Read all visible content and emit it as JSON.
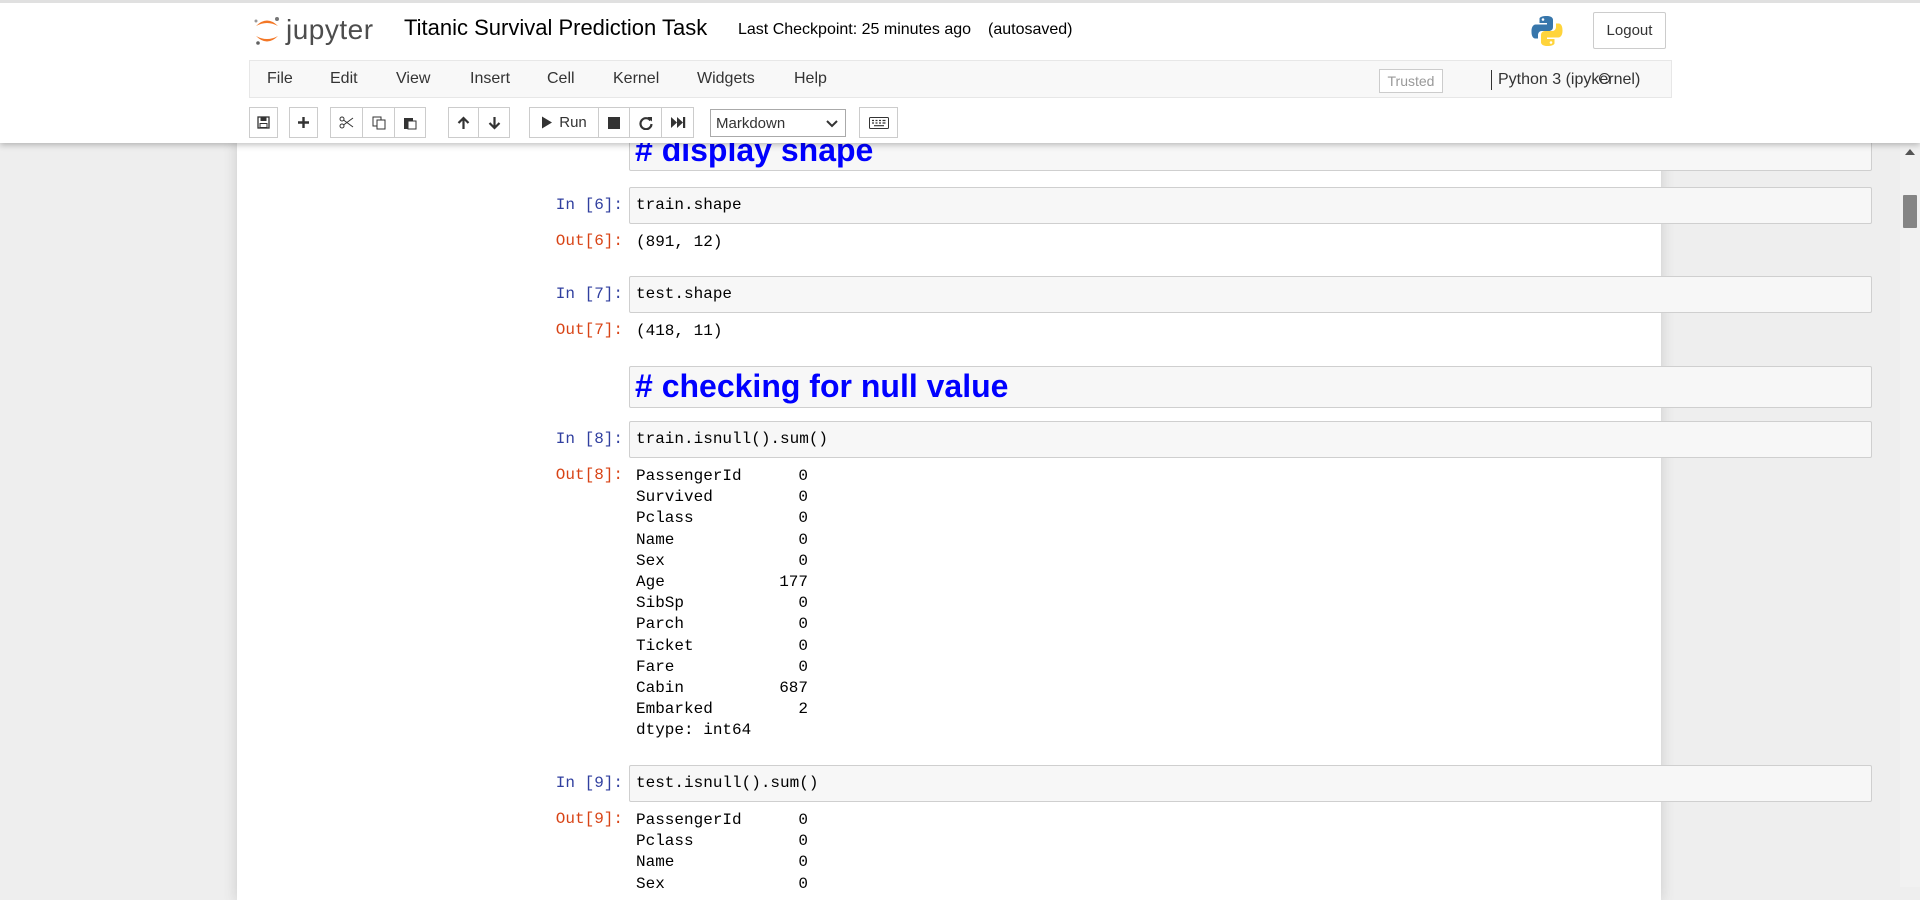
{
  "header": {
    "logo_text": "jupyter",
    "notebook_title": "Titanic Survival Prediction Task",
    "checkpoint": "Last Checkpoint: 25 minutes ago",
    "autosave_status": "(autosaved)",
    "logout_label": "Logout"
  },
  "menubar": {
    "items": [
      "File",
      "Edit",
      "View",
      "Insert",
      "Cell",
      "Kernel",
      "Widgets",
      "Help"
    ],
    "trusted_label": "Trusted",
    "kernel_name": "Python 3 (ipykernel)"
  },
  "toolbar": {
    "run_label": "Run",
    "cell_type": "Markdown"
  },
  "cells": {
    "md1": "# display shape",
    "in6": {
      "prompt": "In [6]:",
      "code": "train.shape"
    },
    "out6": {
      "prompt": "Out[6]:",
      "text": "(891, 12)"
    },
    "in7": {
      "prompt": "In [7]:",
      "code": "test.shape"
    },
    "out7": {
      "prompt": "Out[7]:",
      "text": "(418, 11)"
    },
    "md2": "# checking for null value",
    "in8": {
      "prompt": "In [8]:",
      "code": "train.isnull().sum()"
    },
    "out8": {
      "prompt": "Out[8]:",
      "rows": [
        {
          "k": "PassengerId",
          "v": "0"
        },
        {
          "k": "Survived",
          "v": "0"
        },
        {
          "k": "Pclass",
          "v": "0"
        },
        {
          "k": "Name",
          "v": "0"
        },
        {
          "k": "Sex",
          "v": "0"
        },
        {
          "k": "Age",
          "v": "177"
        },
        {
          "k": "SibSp",
          "v": "0"
        },
        {
          "k": "Parch",
          "v": "0"
        },
        {
          "k": "Ticket",
          "v": "0"
        },
        {
          "k": "Fare",
          "v": "0"
        },
        {
          "k": "Cabin",
          "v": "687"
        },
        {
          "k": "Embarked",
          "v": "2"
        }
      ],
      "dtype": "dtype: int64"
    },
    "in9": {
      "prompt": "In [9]:",
      "code": "test.isnull().sum()"
    },
    "out9": {
      "prompt": "Out[9]:",
      "rows": [
        {
          "k": "PassengerId",
          "v": "0"
        },
        {
          "k": "Pclass",
          "v": "0"
        },
        {
          "k": "Name",
          "v": "0"
        },
        {
          "k": "Sex",
          "v": "0"
        }
      ]
    }
  },
  "colors": {
    "markdown_heading": "#0000ff",
    "in_prompt": "#303f9f",
    "out_prompt": "#d84315"
  }
}
